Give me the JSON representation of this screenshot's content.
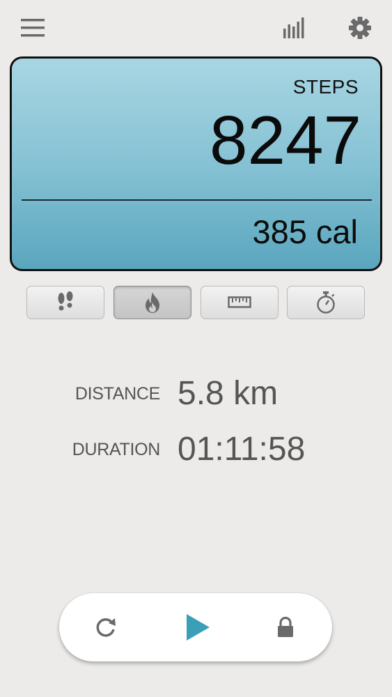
{
  "toolbar": {
    "menu_icon": "hamburger-menu-icon",
    "stats_icon": "bar-chart-icon",
    "settings_icon": "gear-icon"
  },
  "display": {
    "steps_label": "STEPS",
    "steps_value": "8247",
    "calories": "385 cal",
    "gradient_top": "#a8d6e3",
    "gradient_bottom": "#5aa6be"
  },
  "modes": [
    {
      "icon": "footprints-icon",
      "active": false
    },
    {
      "icon": "flame-icon",
      "active": true
    },
    {
      "icon": "ruler-icon",
      "active": false
    },
    {
      "icon": "stopwatch-icon",
      "active": false
    }
  ],
  "stats": {
    "distance_label": "DISTANCE",
    "distance_value": "5.8 km",
    "duration_label": "DURATION",
    "duration_value": "01:11:58"
  },
  "controls": {
    "reset_icon": "reset-icon",
    "play_icon": "play-icon",
    "lock_icon": "lock-icon",
    "accent": "#3b9fb8"
  }
}
